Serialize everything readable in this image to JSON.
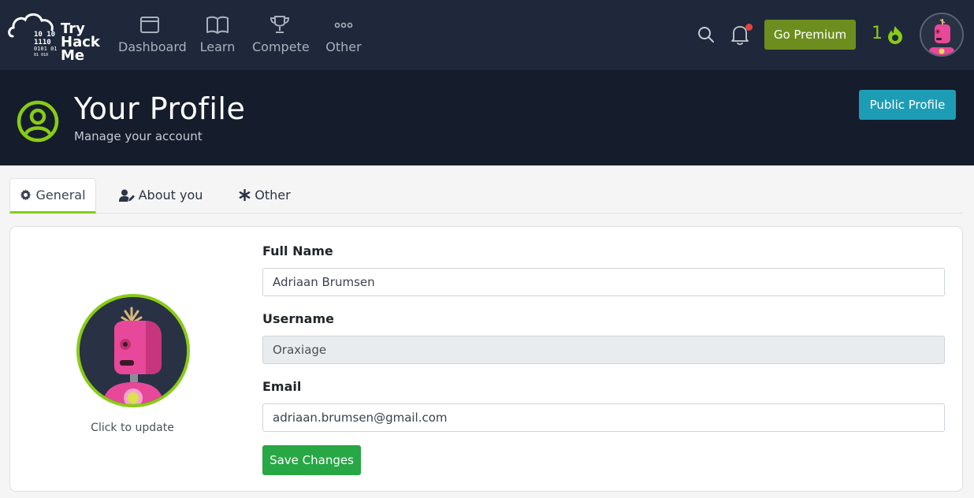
{
  "brand": {
    "logo_text_line1": "Try",
    "logo_text_line2": "Hack",
    "logo_text_line3": "Me",
    "logo_icon": "cloud-binary-logo"
  },
  "nav": {
    "items": [
      {
        "label": "Dashboard",
        "icon": "dashboard-icon"
      },
      {
        "label": "Learn",
        "icon": "book-icon"
      },
      {
        "label": "Compete",
        "icon": "trophy-icon"
      },
      {
        "label": "Other",
        "icon": "dots-icon"
      }
    ],
    "premium_label": "Go Premium",
    "streak_count": "1",
    "notification_unread": true
  },
  "header": {
    "title": "Your Profile",
    "subtitle": "Manage your account",
    "public_profile_label": "Public Profile"
  },
  "tabs": [
    {
      "label": "General",
      "icon": "gear-icon",
      "active": true
    },
    {
      "label": "About you",
      "icon": "user-edit-icon",
      "active": false
    },
    {
      "label": "Other",
      "icon": "asterisk-icon",
      "active": false
    }
  ],
  "form": {
    "avatar_caption": "Click to update",
    "full_name_label": "Full Name",
    "full_name_value": "Adriaan Brumsen",
    "username_label": "Username",
    "username_value": "Oraxiage",
    "email_label": "Email",
    "email_value": "adriaan.brumsen@gmail.com",
    "save_label": "Save Changes"
  },
  "colors": {
    "nav_bg": "#1f283a",
    "header_bg": "#151c2b",
    "accent_green": "#88cc14",
    "premium_green": "#6d8e1e",
    "public_btn": "#1d9db5",
    "save_btn": "#28a745",
    "avatar_pink": "#e8489a"
  }
}
